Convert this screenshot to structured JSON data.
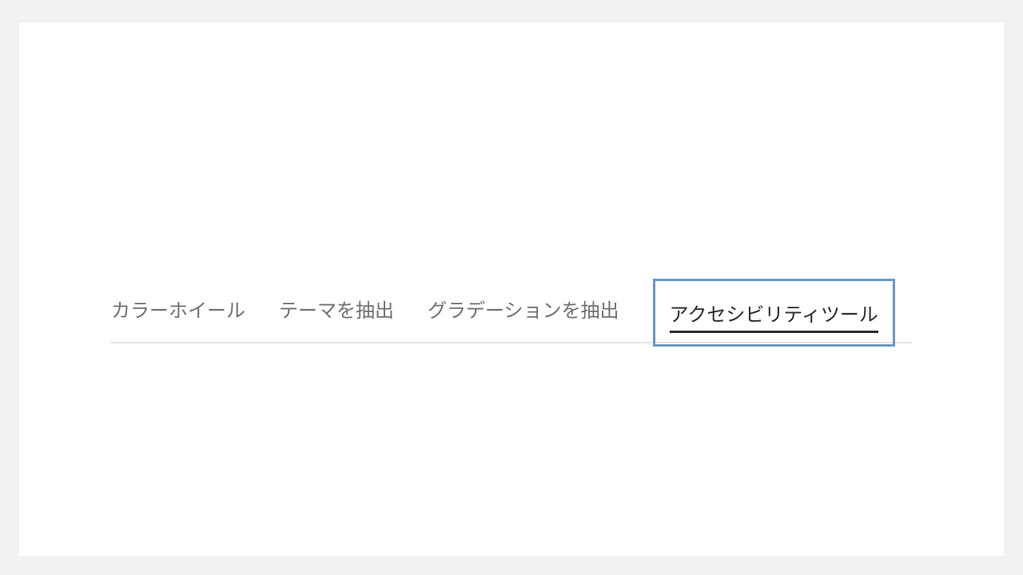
{
  "tabs": {
    "items": [
      {
        "label": "カラーホイール",
        "active": false
      },
      {
        "label": "テーマを抽出",
        "active": false
      },
      {
        "label": "グラデーションを抽出",
        "active": false
      },
      {
        "label": "アクセシビリティツール",
        "active": true
      }
    ]
  }
}
